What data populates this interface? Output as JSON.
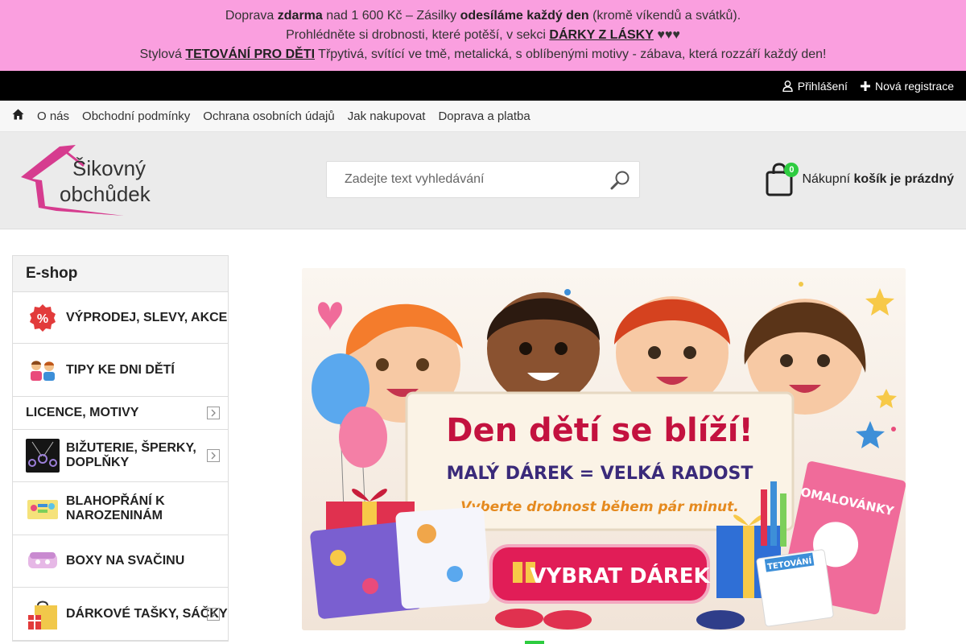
{
  "announcement": {
    "line1_a": "Doprava ",
    "line1_b": "zdarma",
    "line1_c": " nad 1 600 Kč – Zásilky ",
    "line1_d": "odesíláme každý den",
    "line1_e": " (kromě víkendů a svátků).",
    "line2_a": "Prohlédněte si drobnosti, které potěší, v sekci ",
    "line2_link": "DÁRKY Z LÁSKY",
    "line2_b": " ♥♥♥",
    "line3_a": "Stylová ",
    "line3_link": "TETOVÁNÍ PRO DĚTI",
    "line3_b": " Třpytivá, svítící ve tmě, metalická, s oblíbenými motivy - zábava, která rozzáří každý den!"
  },
  "topbar": {
    "login": "Přihlášení",
    "register": "Nová registrace"
  },
  "nav": {
    "items": [
      "O nás",
      "Obchodní podmínky",
      "Ochrana osobních údajů",
      "Jak nakupovat",
      "Doprava a platba"
    ]
  },
  "header": {
    "logo_line1": "Šikovný",
    "logo_line2": "obchůdek",
    "search_placeholder": "Zadejte text vyhledávání",
    "cart_count": "0",
    "cart_text_a": "Nákupní ",
    "cart_text_b": "košík je prázdný"
  },
  "sidebar": {
    "title": "E-shop",
    "items": [
      {
        "label": "VÝPRODEJ, SLEVY, AKCE"
      },
      {
        "label": "TIPY KE DNI DĚTÍ"
      },
      {
        "label": "LICENCE, MOTIVY"
      },
      {
        "label": "BIŽUTERIE, ŠPERKY, DOPLŇKY"
      },
      {
        "label": "BLAHOPŘÁNÍ K NAROZENINÁM"
      },
      {
        "label": "BOXY NA SVAČINU"
      },
      {
        "label": "DÁRKOVÉ TAŠKY, SÁČKY"
      }
    ]
  },
  "banner": {
    "headline": "Den dětí se blíží!",
    "subline": "MALÝ DÁREK = VELKÁ RADOST",
    "tagline": "Vyberte drobnost během pár minut.",
    "button": "VYBRAT DÁREK",
    "book_title": "OMALOVÁNKY",
    "tattoo_label": "TETOVÁNÍ"
  },
  "colors": {
    "announce_bg": "#fa9fdf",
    "topbar_bg": "#000000",
    "brand_pink": "#d63c8f",
    "cart_badge": "#2ecc40",
    "banner_button": "#e11d57"
  }
}
